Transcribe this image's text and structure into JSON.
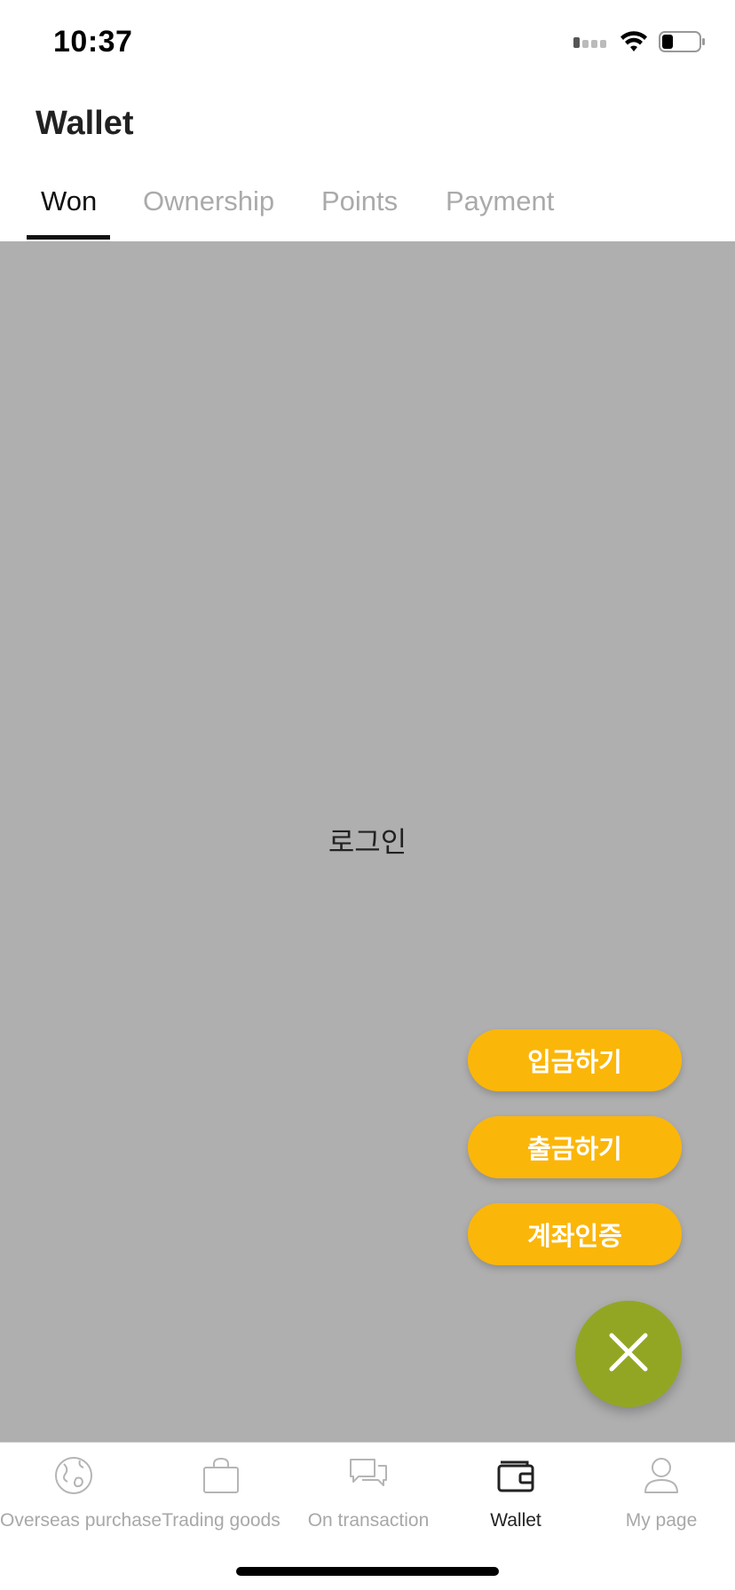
{
  "status_bar": {
    "time": "10:37",
    "icons": [
      "signal-icon",
      "wifi-icon",
      "battery-icon"
    ]
  },
  "header": {
    "title": "Wallet"
  },
  "tabs": [
    {
      "label": "Won",
      "active": true
    },
    {
      "label": "Ownership",
      "active": false
    },
    {
      "label": "Points",
      "active": false
    },
    {
      "label": "Payment",
      "active": false
    }
  ],
  "content": {
    "login_label": "로그인"
  },
  "fab_menu": {
    "deposit_label": "입금하기",
    "withdraw_label": "출금하기",
    "verify_account_label": "계좌인증",
    "close_icon": "close-icon"
  },
  "bottom_nav": [
    {
      "label": "Overseas purchase",
      "icon": "globe-icon",
      "active": false
    },
    {
      "label": "Trading goods",
      "icon": "shopping-bag-icon",
      "active": false
    },
    {
      "label": "On transaction",
      "icon": "chat-icon",
      "active": false
    },
    {
      "label": "Wallet",
      "icon": "wallet-icon",
      "active": true
    },
    {
      "label": "My page",
      "icon": "user-icon",
      "active": false
    }
  ],
  "colors": {
    "accent_yellow": "#fbb60a",
    "fab_green": "#93a624",
    "overlay_gray": "#afafaf"
  }
}
